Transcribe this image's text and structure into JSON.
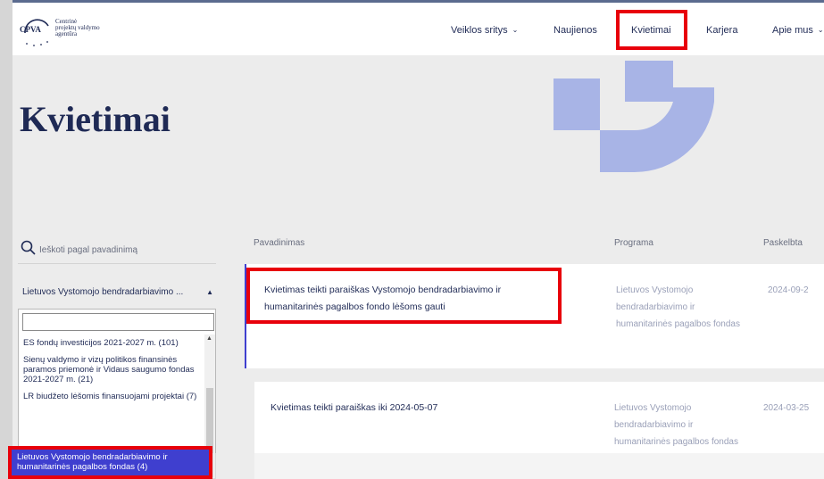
{
  "header": {
    "logo_abbr": "CPVA",
    "logo_lines": [
      "Centrinė",
      "projektų valdymo",
      "agentūra"
    ],
    "nav": [
      {
        "label": "Veiklos sritys",
        "has_dropdown": true
      },
      {
        "label": "Naujienos",
        "has_dropdown": false
      },
      {
        "label": "Kvietimai",
        "has_dropdown": false,
        "active": true
      },
      {
        "label": "Karjera",
        "has_dropdown": false
      },
      {
        "label": "Apie mus",
        "has_dropdown": true
      }
    ]
  },
  "page": {
    "title": "Kvietimai"
  },
  "sidebar": {
    "search_placeholder": "Ieškoti pagal pavadinimą",
    "filter_value": "Lietuvos Vystomojo bendradarbiavimo ...",
    "dropdown_items": [
      "ES fondų investicijos 2021-2027 m. (101)",
      "Sienų valdymo ir vizų politikos finansinės paramos priemonė ir Vidaus saugumo fondas 2021-2027 m. (21)",
      "LR biudžeto lėšomis finansuojami projektai (7)"
    ],
    "dropdown_selected": "Lietuvos Vystomojo bendradarbiavimo ir humanitarinės pagalbos fondas (4)"
  },
  "table": {
    "columns": [
      "Pavadinimas",
      "Programa",
      "Paskelbta"
    ],
    "rows": [
      {
        "title": "Kvietimas teikti paraiškas Vystomojo bendradarbiavimo ir humanitarinės pagalbos fondo lėšoms gauti",
        "program": "Lietuvos Vystomojo bendradarbiavimo ir humanitarinės pagalbos fondas",
        "date": "2024-09-2"
      },
      {
        "title": "Kvietimas teikti paraiškas iki 2024-05-07",
        "program": "Lietuvos Vystomojo bendradarbiavimo ir humanitarinės pagalbos fondas",
        "date": "2024-03-25"
      }
    ]
  },
  "colors": {
    "brand_navy": "#1f2a55",
    "accent_blue": "#3f3fcf",
    "deco_blue": "#a8b4e6",
    "highlight_red": "#e8000b"
  }
}
